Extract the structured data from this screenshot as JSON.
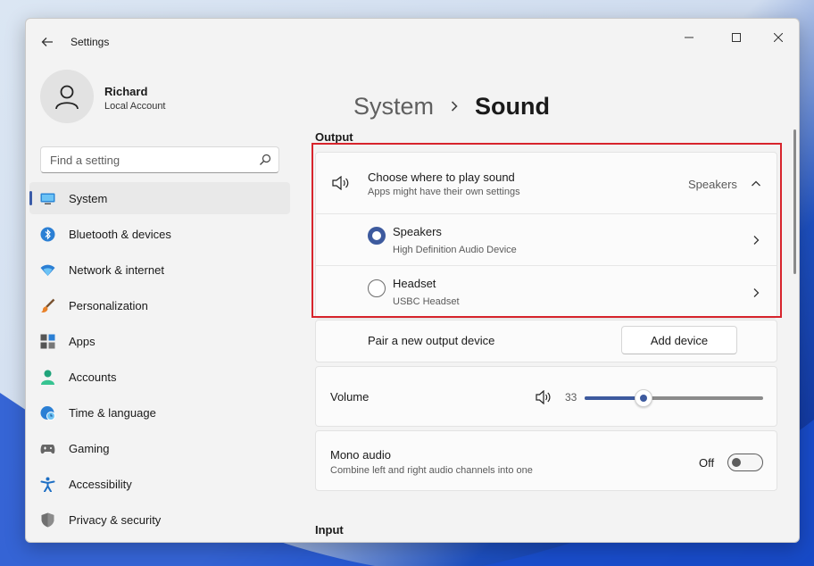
{
  "window": {
    "title": "Settings"
  },
  "account": {
    "name": "Richard",
    "type": "Local Account"
  },
  "search": {
    "placeholder": "Find a setting"
  },
  "nav": {
    "items": [
      {
        "label": "System",
        "icon": "system-icon",
        "active": true
      },
      {
        "label": "Bluetooth & devices",
        "icon": "bluetooth-icon"
      },
      {
        "label": "Network & internet",
        "icon": "wifi-icon"
      },
      {
        "label": "Personalization",
        "icon": "brush-icon"
      },
      {
        "label": "Apps",
        "icon": "apps-icon"
      },
      {
        "label": "Accounts",
        "icon": "person-icon"
      },
      {
        "label": "Time & language",
        "icon": "globe-clock-icon"
      },
      {
        "label": "Gaming",
        "icon": "gamepad-icon"
      },
      {
        "label": "Accessibility",
        "icon": "accessibility-icon"
      },
      {
        "label": "Privacy & security",
        "icon": "shield-icon"
      }
    ]
  },
  "breadcrumb": {
    "parent": "System",
    "current": "Sound"
  },
  "output": {
    "heading": "Output",
    "choose_title": "Choose where to play sound",
    "choose_sub": "Apps might have their own settings",
    "choose_value": "Speakers",
    "devices": [
      {
        "name": "Speakers",
        "sub": "High Definition Audio Device",
        "selected": true
      },
      {
        "name": "Headset",
        "sub": "USBC Headset",
        "selected": false
      }
    ],
    "pair_label": "Pair a new output device",
    "add_button": "Add device"
  },
  "volume": {
    "label": "Volume",
    "value": "33",
    "fraction": 0.33
  },
  "mono": {
    "title": "Mono audio",
    "sub": "Combine left and right audio channels into one",
    "state": "Off"
  },
  "input": {
    "heading": "Input"
  },
  "colors": {
    "accent": "#3d5a9e",
    "highlight": "#d7242c"
  }
}
